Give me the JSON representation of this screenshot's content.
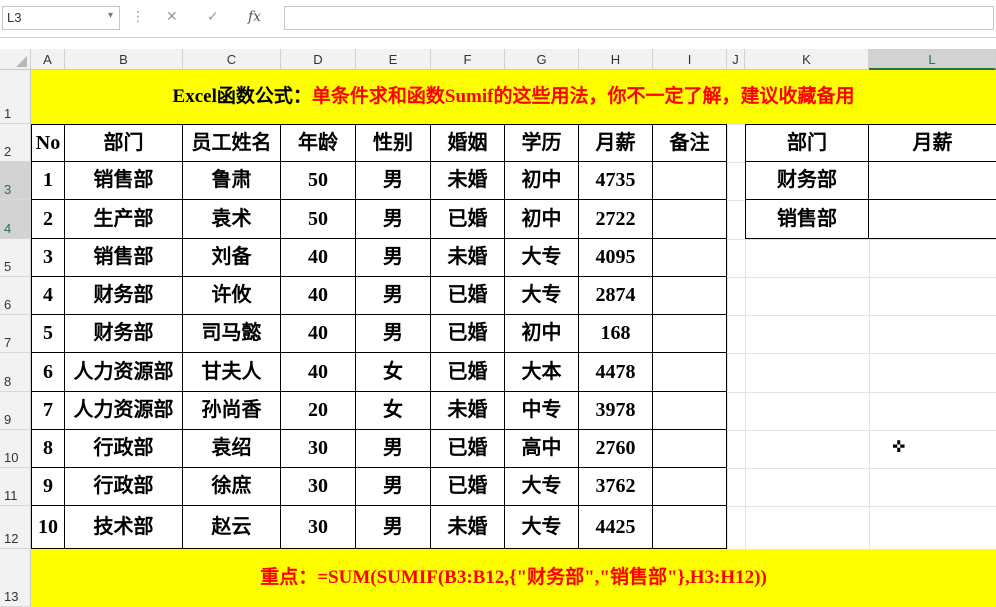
{
  "formula_bar": {
    "name_box": "L3",
    "caret": "▾",
    "separator": "⋮",
    "cancel": "✕",
    "enter": "✓",
    "fx": "fx",
    "formula": ""
  },
  "columns": [
    "A",
    "B",
    "C",
    "D",
    "E",
    "F",
    "G",
    "H",
    "I",
    "J",
    "K",
    "L"
  ],
  "rows": [
    "1",
    "2",
    "3",
    "4",
    "5",
    "6",
    "7",
    "8",
    "9",
    "10",
    "11",
    "12",
    "13"
  ],
  "title": {
    "black": "Excel函数公式：",
    "red": "单条件求和函数Sumif的这些用法，你不一定了解，建议收藏备用"
  },
  "table": {
    "headers": [
      "No",
      "部门",
      "员工姓名",
      "年龄",
      "性别",
      "婚姻",
      "学历",
      "月薪",
      "备注"
    ],
    "rows": [
      [
        "1",
        "销售部",
        "鲁肃",
        "50",
        "男",
        "未婚",
        "初中",
        "4735",
        ""
      ],
      [
        "2",
        "生产部",
        "袁术",
        "50",
        "男",
        "已婚",
        "初中",
        "2722",
        ""
      ],
      [
        "3",
        "销售部",
        "刘备",
        "40",
        "男",
        "未婚",
        "大专",
        "4095",
        ""
      ],
      [
        "4",
        "财务部",
        "许攸",
        "40",
        "男",
        "已婚",
        "大专",
        "2874",
        ""
      ],
      [
        "5",
        "财务部",
        "司马懿",
        "40",
        "男",
        "已婚",
        "初中",
        "168",
        ""
      ],
      [
        "6",
        "人力资源部",
        "甘夫人",
        "40",
        "女",
        "已婚",
        "大本",
        "4478",
        ""
      ],
      [
        "7",
        "人力资源部",
        "孙尚香",
        "20",
        "女",
        "未婚",
        "中专",
        "3978",
        ""
      ],
      [
        "8",
        "行政部",
        "袁绍",
        "30",
        "男",
        "已婚",
        "高中",
        "2760",
        ""
      ],
      [
        "9",
        "行政部",
        "徐庶",
        "30",
        "男",
        "已婚",
        "大专",
        "3762",
        ""
      ],
      [
        "10",
        "技术部",
        "赵云",
        "30",
        "男",
        "未婚",
        "大专",
        "4425",
        ""
      ]
    ]
  },
  "side_table": {
    "headers": [
      "部门",
      "月薪"
    ],
    "rows": [
      [
        "财务部",
        ""
      ],
      [
        "销售部",
        ""
      ]
    ]
  },
  "note": "重点：=SUM(SUMIF(B3:B12,{\"财务部\",\"销售部\"},H3:H12))",
  "active_cell": "L3:L4",
  "icons": {
    "cursor": "cell-select-plus-icon",
    "corner": "select-all-triangle-icon"
  },
  "colors": {
    "band": "#ffff00",
    "title_red": "#ff0000",
    "selection": "#217346"
  }
}
